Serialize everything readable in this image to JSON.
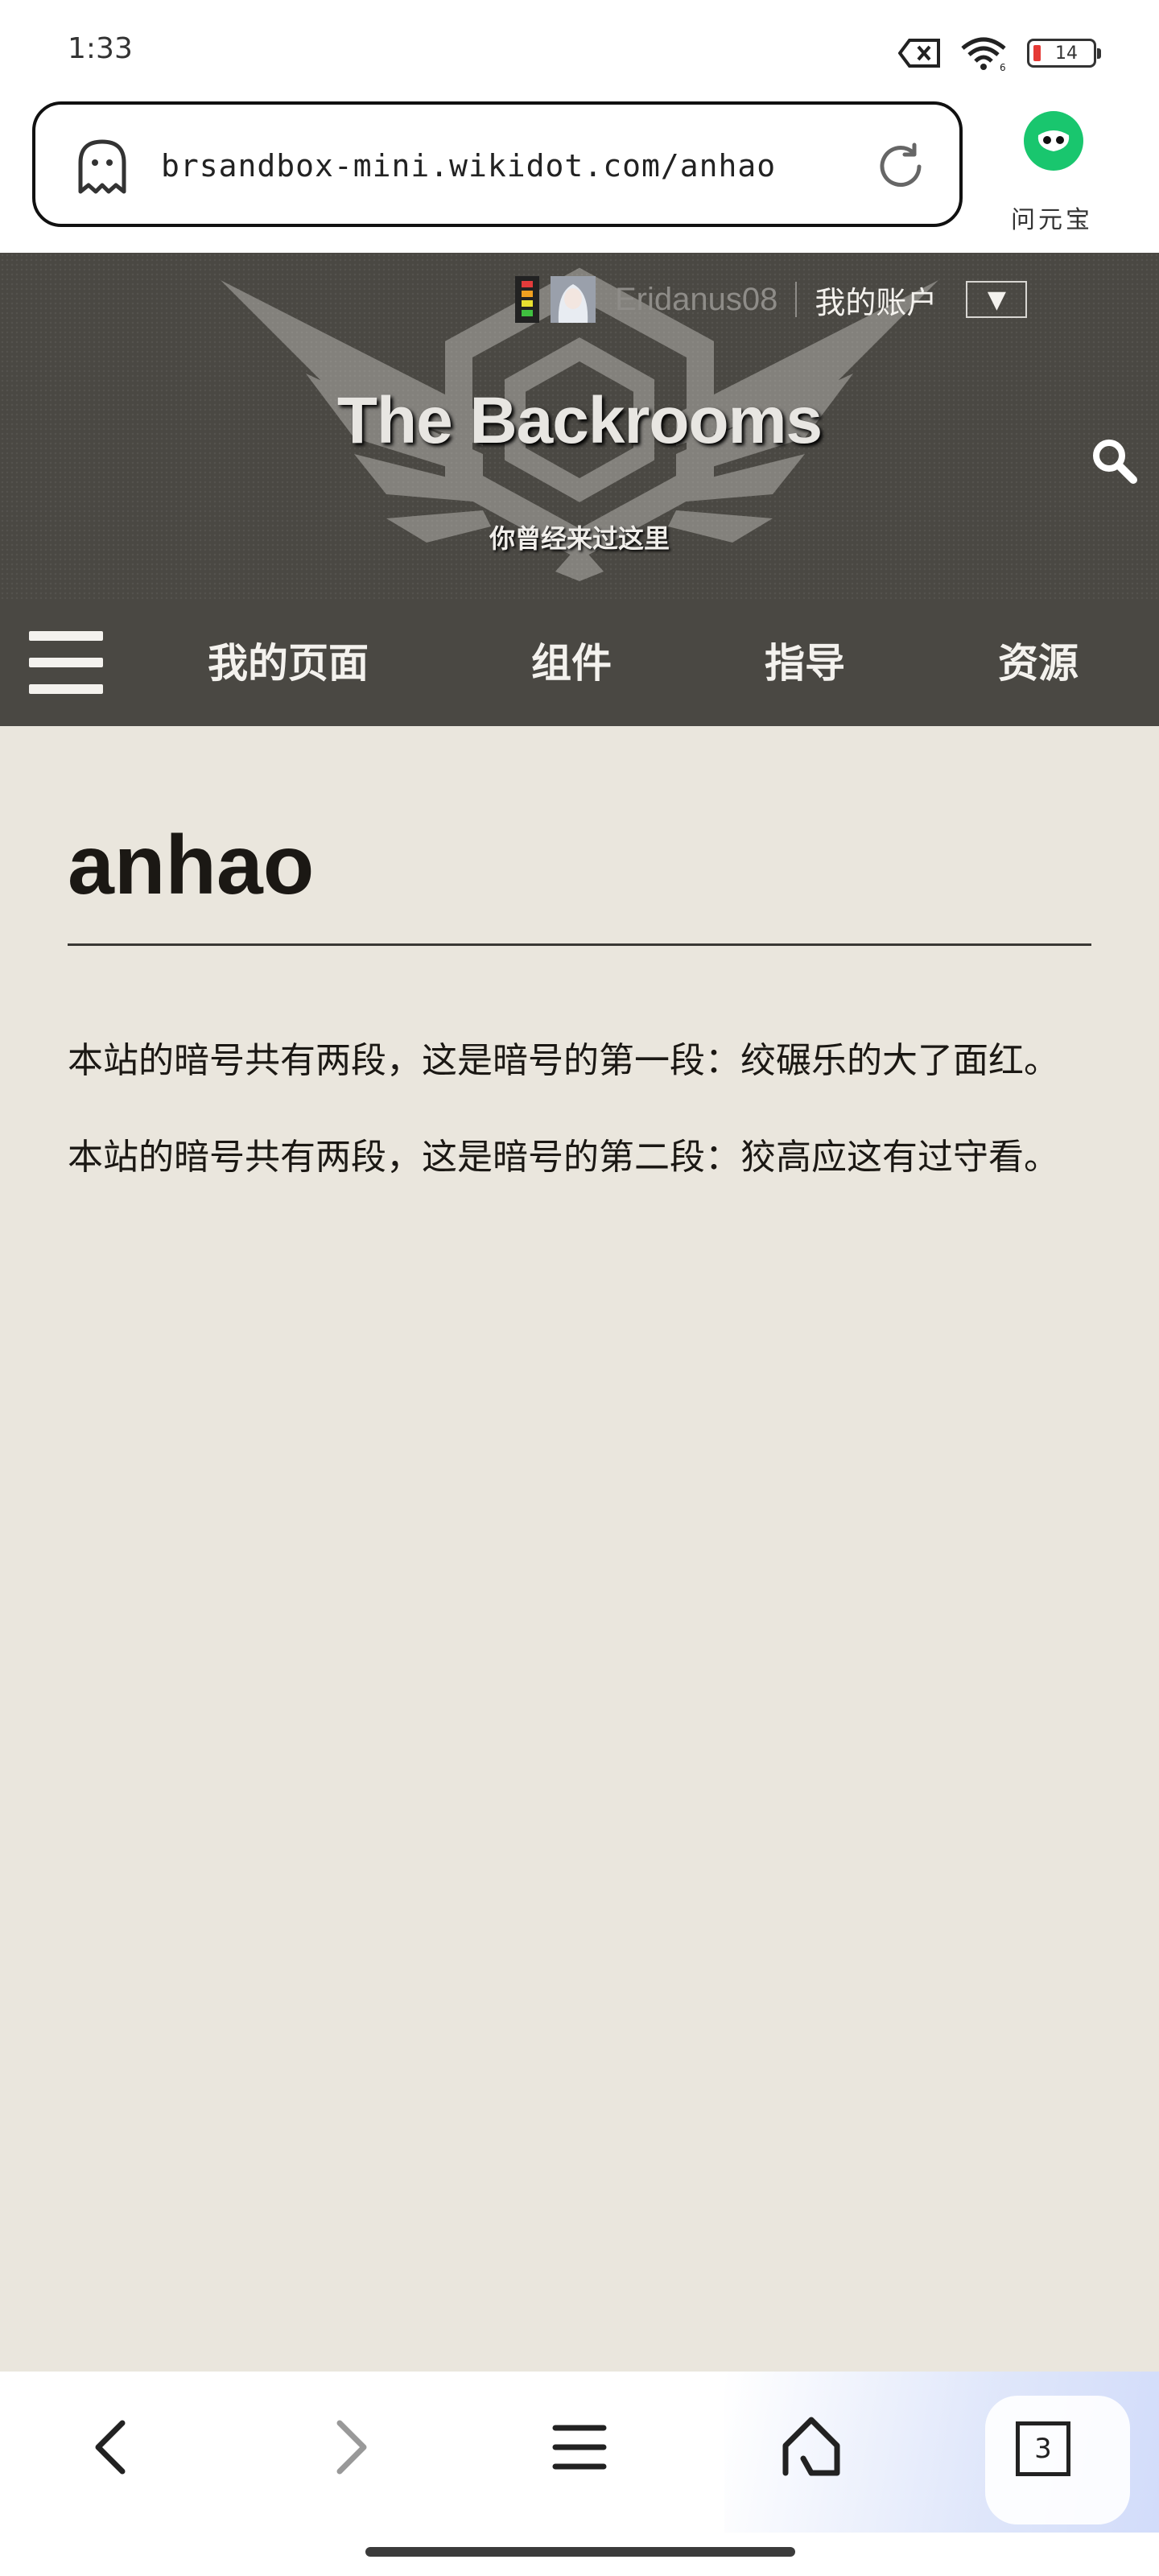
{
  "status_bar": {
    "time": "1:33",
    "battery_level": "14",
    "wifi_badge": "6",
    "icons": [
      "sim-off-icon",
      "wifi-icon",
      "battery-low-icon"
    ]
  },
  "browser": {
    "url": "brsandbox-mini.wikidot.com/anhao",
    "assistant_label": "问元宝",
    "tab_count": "3",
    "icons": [
      "ghost-icon",
      "reload-icon",
      "back-icon",
      "forward-icon",
      "menu-icon",
      "home-icon",
      "tabs-icon"
    ]
  },
  "site": {
    "username": "Eridanus08",
    "account_label": "我的账户",
    "account_toggle": "▼",
    "title": "The Backrooms",
    "subtitle": "你曾经来过这里"
  },
  "nav": {
    "items": [
      {
        "label": "我的页面"
      },
      {
        "label": "组件"
      },
      {
        "label": "指导"
      },
      {
        "label": "资源"
      }
    ]
  },
  "page": {
    "title": "anhao",
    "paragraphs": [
      "本站的暗号共有两段，这是暗号的第一段：绞碾乐的大了面红。",
      "本站的暗号共有两段，这是暗号的第二段：狡高应这有过守看。"
    ]
  },
  "colors": {
    "header_bg": "#4a4843",
    "page_bg": "#eae6dd",
    "text": "#1b1814",
    "assistant_green": "#19c66e"
  }
}
